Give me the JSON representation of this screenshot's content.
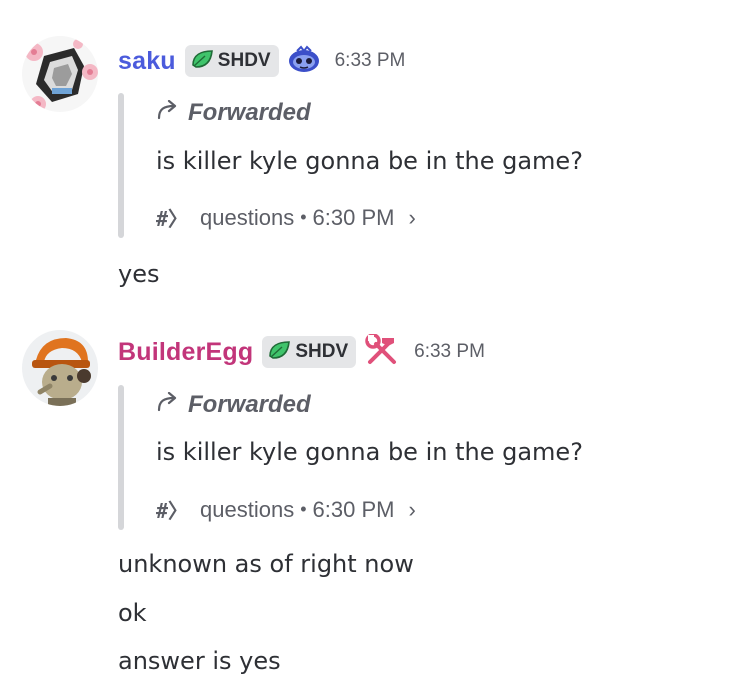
{
  "messages": [
    {
      "username": "saku",
      "username_color": "#4b5bdc",
      "tag": "SHDV",
      "role_icon": "blue-slime-icon",
      "timestamp": "6:33 PM",
      "forward": {
        "label": "Forwarded",
        "text": "is killer kyle gonna be in the game?",
        "channel_icon": "#〉",
        "channel": "questions",
        "separator": "•",
        "time": "6:30 PM",
        "chevron": "›"
      },
      "replies": [
        "yes"
      ]
    },
    {
      "username": "BuilderEgg",
      "username_color": "#c2357a",
      "tag": "SHDV",
      "role_icon": "hammer-wrench-icon",
      "timestamp": "6:33 PM",
      "forward": {
        "label": "Forwarded",
        "text": "is killer kyle gonna be in the game?",
        "channel_icon": "#〉",
        "channel": "questions",
        "separator": "•",
        "time": "6:30 PM",
        "chevron": "›"
      },
      "replies": [
        "unknown as of right now",
        "ok",
        "answer is yes"
      ]
    }
  ]
}
